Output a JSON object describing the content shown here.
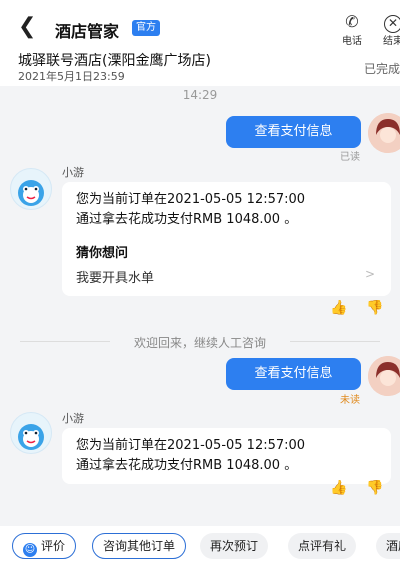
{
  "header": {
    "title": "酒店管家",
    "badge": "官方",
    "call_label": "电话",
    "end_label": "结束"
  },
  "order": {
    "hotel": "城驿联号酒店(溧阳金鹰广场店)",
    "time": "2021年5月1日23:59",
    "status": "已完成"
  },
  "chat": {
    "timestamp": "14:29",
    "user_msg_1": "查看支付信息",
    "read_1": "已读",
    "bot_name": "小游",
    "bot_msg_1_line1": "您为当前订单在2021-05-05 12:57:00",
    "bot_msg_1_line2": "通过拿去花成功支付RMB 1048.00 。",
    "guess_title": "猜你想问",
    "guess_item": "我要开具水单",
    "divider_text": "欢迎回来，继续人工咨询",
    "user_msg_2": "查看支付信息",
    "read_2": "未读",
    "bot_msg_2_line1": "您为当前订单在2021-05-05 12:57:00",
    "bot_msg_2_line2": "通过拿去花成功支付RMB 1048.00 。"
  },
  "quick_actions": [
    "评价",
    "咨询其他订单",
    "再次预订",
    "点评有礼",
    "酒店"
  ],
  "colors": {
    "accent": "#2d7ff0",
    "unread": "#e08a1e",
    "read": "#999999"
  }
}
